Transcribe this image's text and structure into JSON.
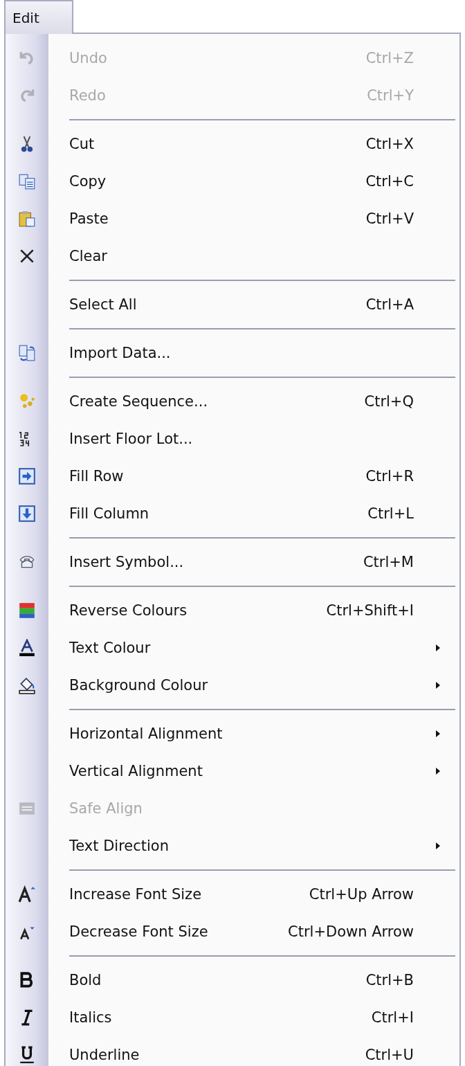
{
  "menu_tab": {
    "label": "Edit",
    "selected": true
  },
  "sections": [
    {
      "items": [
        {
          "label": "Undo",
          "shortcut": "Ctrl+Z",
          "disabled": true
        },
        {
          "label": "Redo",
          "shortcut": "Ctrl+Y",
          "disabled": true
        }
      ]
    },
    {
      "items": [
        {
          "label": "Cut",
          "shortcut": "Ctrl+X",
          "disabled": false
        },
        {
          "label": "Copy",
          "shortcut": "Ctrl+C",
          "disabled": false
        },
        {
          "label": "Paste",
          "shortcut": "Ctrl+V",
          "disabled": false
        },
        {
          "label": "Clear",
          "disabled": false
        }
      ]
    },
    {
      "items": [
        {
          "label": "Select All",
          "shortcut": "Ctrl+A",
          "disabled": false
        }
      ]
    },
    {
      "items": [
        {
          "label": "Import Data...",
          "disabled": false
        }
      ]
    },
    {
      "items": [
        {
          "label": "Create Sequence...",
          "shortcut": "Ctrl+Q",
          "disabled": false
        },
        {
          "label": "Insert Floor Lot...",
          "disabled": false
        },
        {
          "label": "Fill Row",
          "shortcut": "Ctrl+R",
          "disabled": false
        },
        {
          "label": "Fill Column",
          "shortcut": "Ctrl+L",
          "disabled": false
        }
      ]
    },
    {
      "items": [
        {
          "label": "Insert Symbol...",
          "shortcut": "Ctrl+M",
          "disabled": false
        }
      ]
    },
    {
      "items": [
        {
          "label": "Reverse Colours",
          "shortcut": "Ctrl+Shift+I",
          "disabled": false
        },
        {
          "label": "Text Colour",
          "submenu": true,
          "disabled": false
        },
        {
          "label": "Background Colour",
          "submenu": true,
          "disabled": false
        }
      ]
    },
    {
      "items": [
        {
          "label": "Horizontal Alignment",
          "submenu": true,
          "disabled": false
        },
        {
          "label": "Vertical Alignment",
          "submenu": true,
          "disabled": false
        },
        {
          "label": "Safe Align",
          "disabled": true
        },
        {
          "label": "Text Direction",
          "submenu": true,
          "disabled": false
        }
      ]
    },
    {
      "items": [
        {
          "label": "Increase Font Size",
          "shortcut": "Ctrl+Up Arrow",
          "disabled": false
        },
        {
          "label": "Decrease Font Size",
          "shortcut": "Ctrl+Down Arrow",
          "disabled": false
        }
      ]
    },
    {
      "items": [
        {
          "label": "Bold",
          "shortcut": "Ctrl+B",
          "disabled": false
        },
        {
          "label": "Italics",
          "shortcut": "Ctrl+I",
          "disabled": false
        },
        {
          "label": "Underline",
          "shortcut": "Ctrl+U",
          "disabled": false
        }
      ]
    }
  ]
}
